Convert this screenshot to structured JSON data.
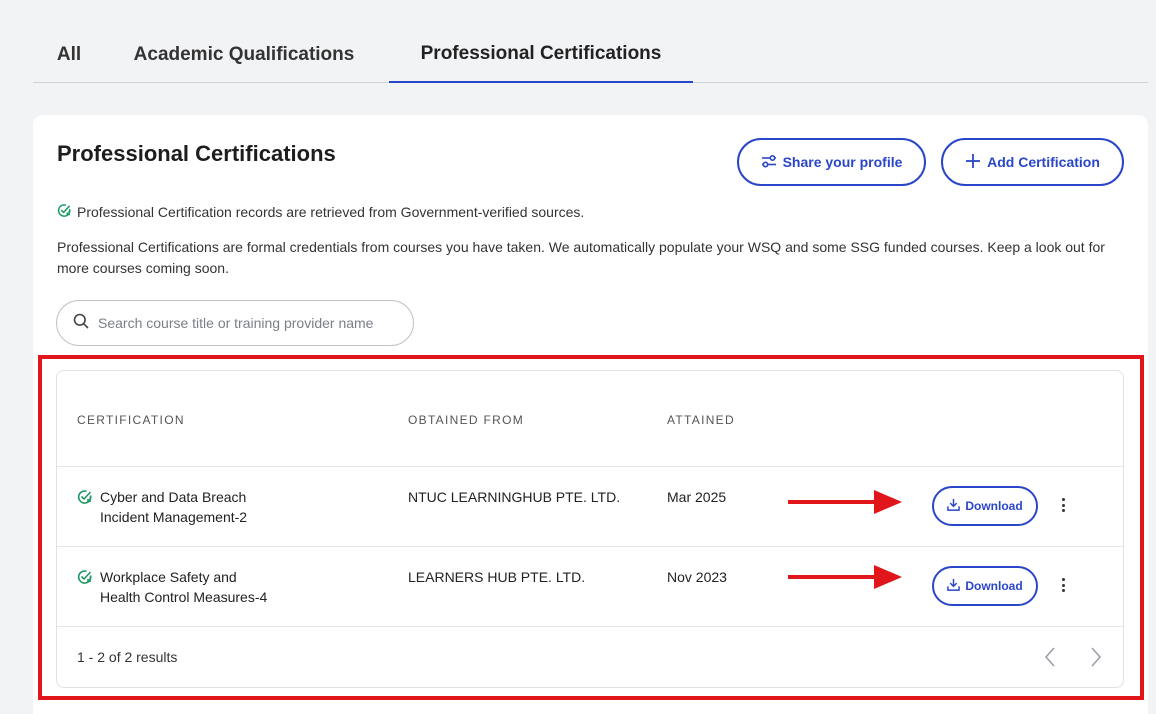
{
  "tabs": [
    {
      "label": "All"
    },
    {
      "label": "Academic Qualifications"
    },
    {
      "label": "Professional Certifications"
    }
  ],
  "card": {
    "title": "Professional Certifications",
    "share_label": "Share your profile",
    "add_label": "Add Certification",
    "verified_text": "Professional Certification records are retrieved from Government-verified sources.",
    "description": "Professional Certifications are formal credentials from courses you have taken. We automatically populate your WSQ and some SSG funded courses. Keep a look out for more courses coming soon.",
    "search_placeholder": "Search course title or training provider name"
  },
  "table": {
    "headers": {
      "certification": "CERTIFICATION",
      "obtained_from": "OBTAINED FROM",
      "attained": "ATTAINED"
    },
    "rows": [
      {
        "cert_line1": "Cyber and Data Breach",
        "cert_line2": "Incident Management-2",
        "provider": "NTUC LEARNINGHUB PTE. LTD.",
        "attained": "Mar 2025",
        "download_label": "Download"
      },
      {
        "cert_line1": "Workplace Safety and",
        "cert_line2": "Health Control Measures-4",
        "provider": "LEARNERS HUB PTE. LTD.",
        "attained": "Nov 2023",
        "download_label": "Download"
      }
    ],
    "results_text": "1 - 2 of 2 results"
  },
  "colors": {
    "accent": "#2a46c8",
    "verified_green": "#1d9a63",
    "annotation_red": "#e0161b"
  },
  "icons": {
    "verified": "verified-check-icon",
    "share": "sliders-icon",
    "add": "plus-icon",
    "search": "search-icon",
    "download": "download-icon",
    "more": "kebab-icon",
    "prev": "chevron-left-icon",
    "next": "chevron-right-icon"
  }
}
